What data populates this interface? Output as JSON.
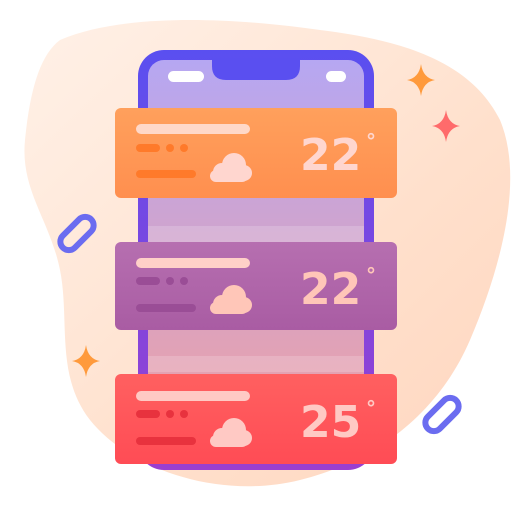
{
  "illustration": {
    "cards": [
      {
        "temperature": "22",
        "degree_symbol": "°",
        "weather_icon": "cloud-icon",
        "color": "#ff9a57"
      },
      {
        "temperature": "22",
        "degree_symbol": "°",
        "weather_icon": "cloud-icon",
        "color": "#b16aa9"
      },
      {
        "temperature": "25",
        "degree_symbol": "°",
        "weather_icon": "cloud-icon",
        "color": "#ff5a5c"
      }
    ],
    "colors": {
      "blob": "#ffe3d1",
      "phone_frame": "#5b4fe6",
      "phone_screen": "#b8a6f0",
      "text_light": "#ffd6cf",
      "sparkle_orange": "#ff9a3c",
      "sparkle_red": "#ff6b6b",
      "ring_purple": "#6b6cf0"
    }
  }
}
